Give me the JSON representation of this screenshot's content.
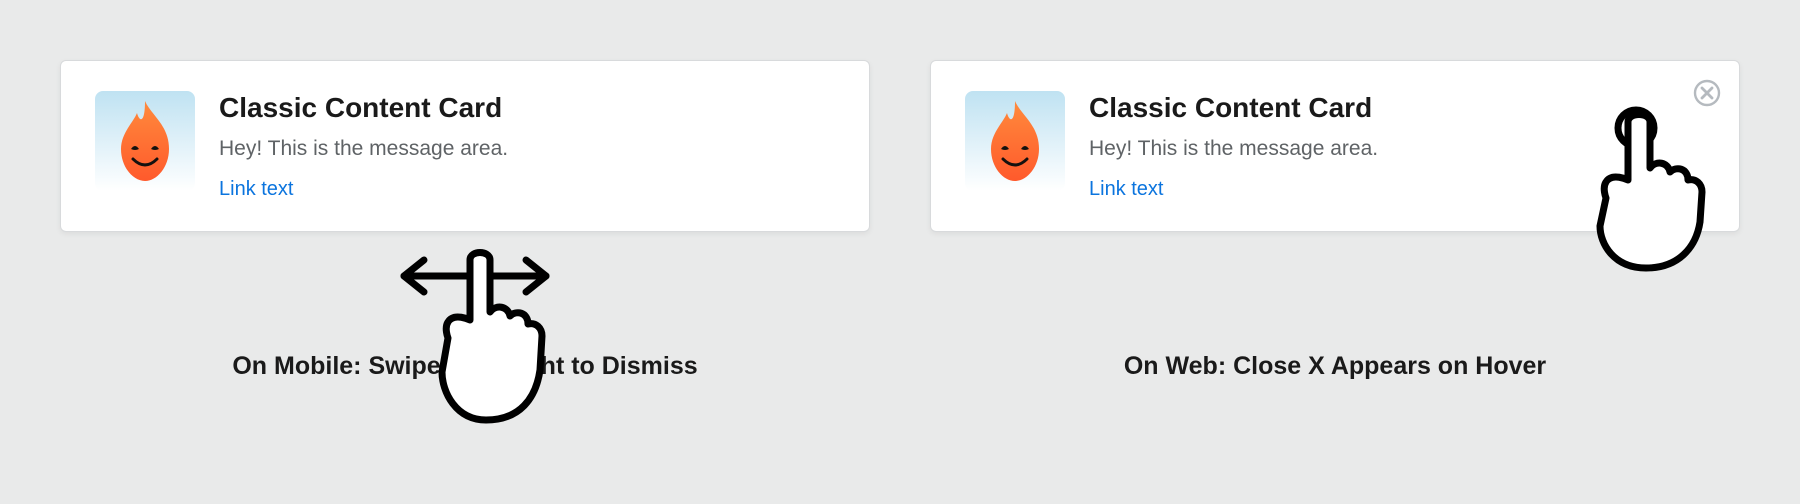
{
  "cards": [
    {
      "title": "Classic Content Card",
      "message": "Hey! This is the message area.",
      "link": "Link text",
      "caption": "On Mobile: Swipe Left/Right to Dismiss"
    },
    {
      "title": "Classic Content Card",
      "message": "Hey! This is the message area.",
      "link": "Link text",
      "caption": "On Web: Close X Appears on Hover"
    }
  ],
  "icon_name": "flame-icon",
  "colors": {
    "link": "#0b74de",
    "text": "#1a1a1a",
    "muted": "#5f6366"
  }
}
